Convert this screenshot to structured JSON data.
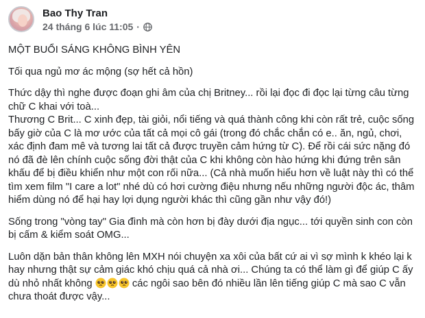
{
  "author": {
    "name": "Bao Thy Tran"
  },
  "meta": {
    "date": "24 tháng 6 lúc 11:05",
    "separator": "·",
    "privacy_icon": "globe-icon"
  },
  "post": {
    "title": "MỘT BUỔI SÁNG KHÔNG BÌNH YÊN",
    "p1": "Tối qua ngủ mơ ác mộng (sợ hết cả hồn)",
    "p2": "Thức dậy thì nghe được đoạn ghi âm của chị Britney... rồi lại đọc đi đọc lại từng câu từng chữ C khai với toà...\nThương C Brit... C xinh đẹp, tài giỏi, nổi tiếng và quá thành công khi còn rất trẻ, cuộc sống bấy giờ của C là mơ ước của tất cả mọi cô gái (trong đó chắc chắn có e.. ăn, ngủ, chơi, xác định đam mê và tương lai tất cả được truyền cảm hứng từ C). Để rồi cái sức nặng đó nó đã đè lên chính cuộc sống đời thật của C khi không còn hào hứng khi đứng trên sân khấu để bị điều khiển như một con rối nữa... (Cả nhà muốn hiểu hơn về luật này thì có thể tìm xem film \"I care a lot\" nhé dù có hơi cường điệu nhưng nếu những người độc ác, thâm hiểm dùng nó để hại hay lợi dụng người khác thì cũng gần như vậy đó!)",
    "p3": "Sống trong \"vòng tay\" Gia đình mà còn hơn bị đày dưới địa ngục... tới quyền sinh con còn bị cấm & kiểm soát OMG...",
    "p4_before": "Luôn dặn bản thân không lên MXH nói chuyện xa xôi của bất cứ ai vì sợ mình k khéo lại k hay nhưng thật sự cảm giác khó chịu quá cả nhà ơi... Chúng ta có thể làm gì để giúp C ấy dù nhỏ nhất không ",
    "p4_emoji": "pleading-face-emoji",
    "p4_after": " các ngôi sao bên đó nhiều lần lên tiếng giúp C mà sao C vẫn chưa thoát được vậy..."
  }
}
